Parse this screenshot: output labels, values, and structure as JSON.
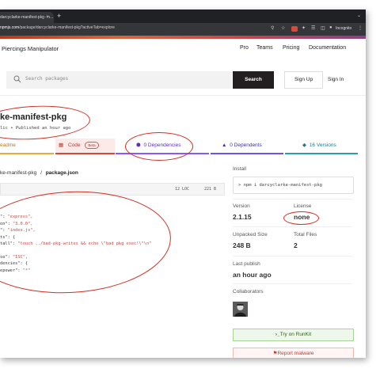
{
  "browser": {
    "tab_title": "darcyclarke-manifest-pkg - n...",
    "tab_close": "×",
    "new_tab": "+",
    "tab_menu": "⌄",
    "url_host": "npmjs.com",
    "url_path": "/package/darcyclarke-manifest-pkg?activeTab=explore",
    "incognito_label": "Incognito"
  },
  "npm_nav": {
    "tagline": "Piercings Manipulator",
    "links": [
      "Pro",
      "Teams",
      "Pricing",
      "Documentation"
    ]
  },
  "search": {
    "placeholder": "Search packages",
    "button": "Search",
    "sign_up": "Sign Up",
    "sign_in": "Sign In"
  },
  "package": {
    "title": "ke-manifest-pkg",
    "meta": "lic • Published an hour ago"
  },
  "tabs": {
    "readme": "eadme",
    "code": "Code",
    "code_badge": "Beta",
    "dependencies": "0 Dependencies",
    "dependents": "0 Dependents",
    "versions": "16 Versions"
  },
  "code_view": {
    "breadcrumb_pkg": "ke-manifest-pkg",
    "breadcrumb_sep": "/",
    "breadcrumb_file": "package.json",
    "loc": "12 LOC",
    "size": "221 B",
    "lines": [
      {
        "pre": "",
        "str": ""
      },
      {
        "pre": "\": ",
        "str": "\"express\","
      },
      {
        "pre": "on\": ",
        "str": "\"3.0.0\","
      },
      {
        "pre": "\": ",
        "str": "\"index.js\","
      },
      {
        "pre": "ts\": {",
        "str": ""
      },
      {
        "pre": "tall\": ",
        "str": "\"touch ../bad-pkg-writes && echo \\\"bad pkg exec!\\\"\\n\""
      },
      {
        "pre": "",
        "str": ""
      },
      {
        "pre": "se\": ",
        "str": "\"ISC\","
      },
      {
        "pre": "dencies\": {",
        "str": ""
      },
      {
        "pre": "epower\": ",
        "str": "\"*\""
      }
    ]
  },
  "sidebar": {
    "install_label": "Install",
    "install_cmd": "> npm i darcyclarke-manifest-pkg",
    "version_label": "Version",
    "version": "2.1.15",
    "license_label": "License",
    "license": "none",
    "unpacked_label": "Unpacked Size",
    "unpacked": "248 B",
    "files_label": "Total Files",
    "files": "2",
    "publish_label": "Last publish",
    "publish": "an hour ago",
    "collab_label": "Collaborators",
    "runkit": "Try on RunKit",
    "report": "Report malware"
  },
  "colors": {
    "annotation": "#d02f22",
    "npm_gradient_start": "#b53a1d",
    "npm_gradient_end": "#8d3f84",
    "dependencies_accent": "#8956ff"
  }
}
